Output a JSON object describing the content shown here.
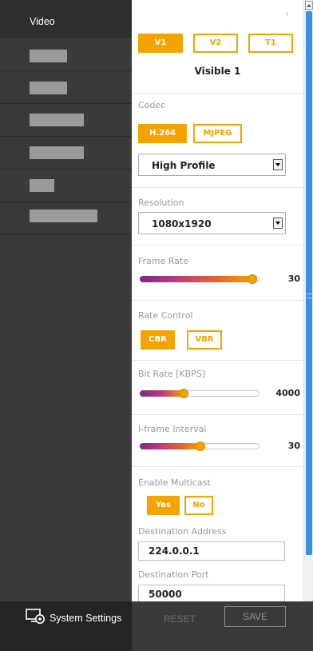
{
  "sidebar": {
    "active_label": "Video",
    "system_settings_label": "System Settings"
  },
  "panel": {
    "collapse_icon": "‹",
    "stream_tabs": [
      "V1",
      "V2",
      "T1"
    ],
    "selected_stream": "V1",
    "stream_name": "Visible 1",
    "codec": {
      "label": "Codec",
      "options": [
        "H.264",
        "MJPEG"
      ],
      "selected": "H.264",
      "profile": "High Profile"
    },
    "resolution": {
      "label": "Resolution",
      "value": "1080x1920"
    },
    "frame_rate": {
      "label": "Frame Rate",
      "value": "30",
      "level": 0.97
    },
    "rate_control": {
      "label": "Rate Control",
      "options": [
        "CBR",
        "VBR"
      ],
      "selected": "CBR"
    },
    "bit_rate": {
      "label": "Bit Rate [KBPS]",
      "value": "4000",
      "level": 0.35
    },
    "iframe_interval": {
      "label": "I-frame Interval",
      "value": "30",
      "level": 0.5
    },
    "multicast": {
      "label": "Enable Multicast",
      "options": [
        "Yes",
        "No"
      ],
      "selected": "Yes"
    },
    "destination_address": {
      "label": "Destination Address",
      "value": "224.0.0.1"
    },
    "destination_port": {
      "label": "Destination Port",
      "value": "50000"
    }
  },
  "footer": {
    "reset_label": "RESET",
    "save_label": "SAVE"
  },
  "colors": {
    "accent": "#f5a300",
    "sidebar_bg": "#3a3a3a",
    "scroll_thumb": "#3b8fe0"
  },
  "icons": [
    "system-settings-icon",
    "collapse-icon",
    "dropdown-arrow-icon"
  ]
}
